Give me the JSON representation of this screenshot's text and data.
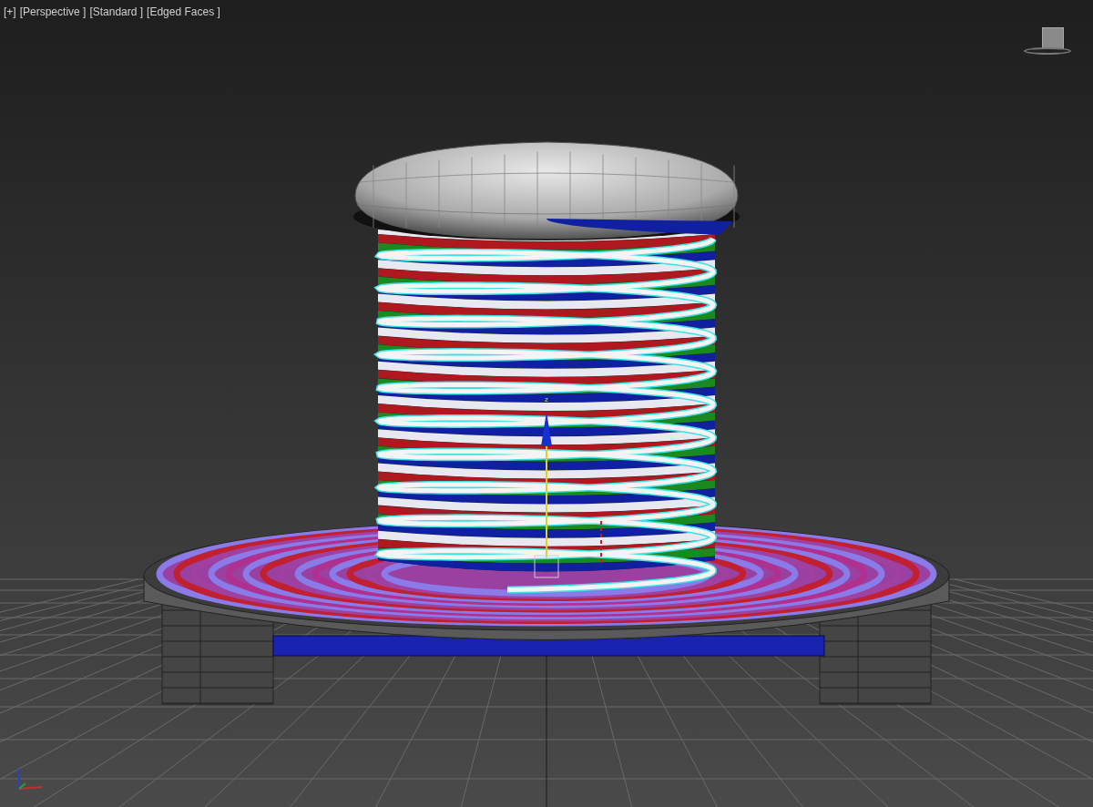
{
  "viewport": {
    "labels": [
      {
        "text": "[+]"
      },
      {
        "text": "[Perspective ]"
      },
      {
        "text": "[Standard ]"
      },
      {
        "text": "[Edged Faces ]"
      }
    ]
  },
  "gizmo": {
    "axis_label": "z"
  }
}
